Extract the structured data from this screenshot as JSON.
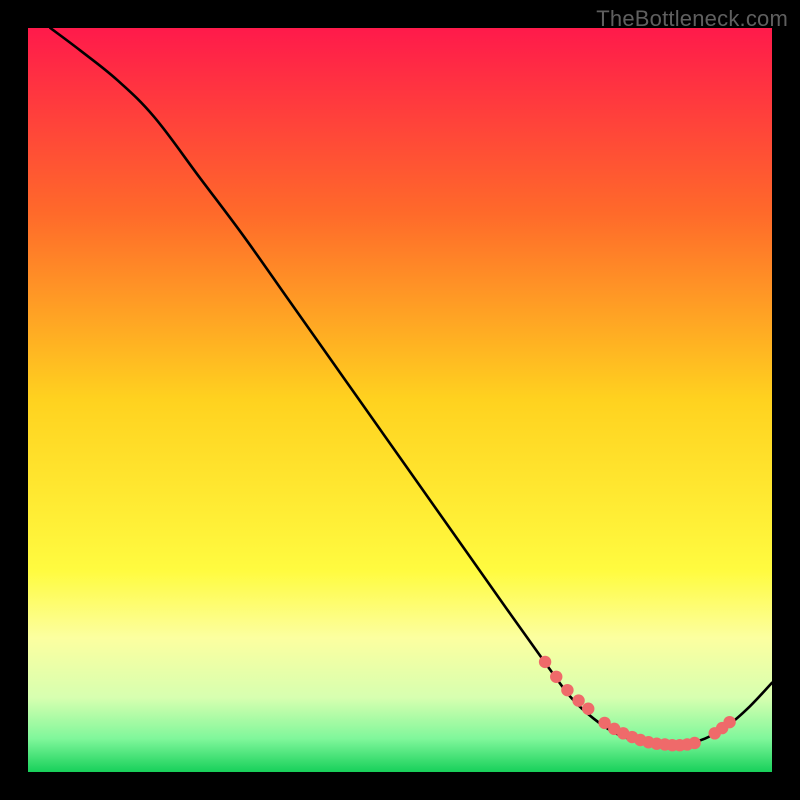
{
  "watermark": "TheBottleneck.com",
  "chart_data": {
    "type": "line",
    "title": "",
    "xlabel": "",
    "ylabel": "",
    "xlim": [
      0,
      100
    ],
    "ylim": [
      0,
      100
    ],
    "grid": false,
    "legend": false,
    "gradient_stops": [
      {
        "offset": 0.0,
        "color": "#ff1a4b"
      },
      {
        "offset": 0.25,
        "color": "#ff6a2a"
      },
      {
        "offset": 0.5,
        "color": "#ffd21f"
      },
      {
        "offset": 0.73,
        "color": "#fffb40"
      },
      {
        "offset": 0.82,
        "color": "#fcffa0"
      },
      {
        "offset": 0.9,
        "color": "#d7ffb0"
      },
      {
        "offset": 0.955,
        "color": "#80f79b"
      },
      {
        "offset": 1.0,
        "color": "#17d05a"
      }
    ],
    "series": [
      {
        "name": "curve",
        "type": "line",
        "color": "#000000",
        "x": [
          3,
          7,
          12,
          17,
          23,
          29,
          35,
          41,
          47,
          53,
          59,
          65,
          70,
          73,
          76,
          79,
          82,
          85,
          88,
          91,
          94,
          97,
          100
        ],
        "y": [
          100,
          97,
          93,
          88,
          80,
          72,
          63.5,
          55,
          46.5,
          38,
          29.5,
          21,
          14,
          10,
          7.2,
          5.2,
          4.1,
          3.6,
          3.7,
          4.5,
          6.2,
          8.8,
          12
        ]
      },
      {
        "name": "dots",
        "type": "scatter",
        "color": "#ef6a6a",
        "x": [
          69.5,
          71,
          72.5,
          74,
          75.3,
          77.5,
          78.8,
          80,
          81.2,
          82.3,
          83.4,
          84.5,
          85.6,
          86.6,
          87.6,
          88.6,
          89.6,
          92.3,
          93.3,
          94.3
        ],
        "y": [
          14.8,
          12.8,
          11.0,
          9.6,
          8.5,
          6.6,
          5.8,
          5.2,
          4.7,
          4.3,
          4.0,
          3.8,
          3.7,
          3.6,
          3.6,
          3.7,
          3.9,
          5.2,
          5.9,
          6.7
        ]
      }
    ]
  }
}
